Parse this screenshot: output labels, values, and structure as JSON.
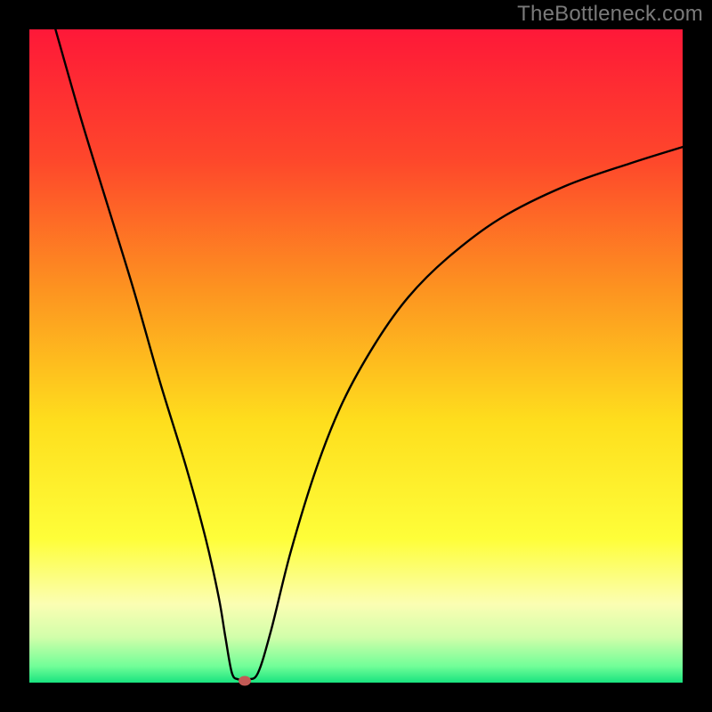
{
  "watermark": "TheBottleneck.com",
  "chart_data": {
    "type": "line",
    "title": "",
    "xlabel": "",
    "ylabel": "",
    "xlim": [
      0,
      100
    ],
    "ylim": [
      0,
      100
    ],
    "grid": false,
    "series": [
      {
        "name": "curve",
        "x": [
          4,
          8,
          12,
          16,
          20,
          24,
          27,
          29,
          30,
          31,
          32,
          33.5,
          35,
          37,
          40,
          44,
          48,
          53,
          58,
          64,
          72,
          82,
          92,
          100
        ],
        "y": [
          100,
          86,
          73,
          60,
          46,
          33,
          22,
          13,
          7,
          1.5,
          0.5,
          0.5,
          1.5,
          8,
          20,
          33,
          43,
          52,
          59,
          65,
          71,
          76,
          79.5,
          82
        ]
      }
    ],
    "marker": {
      "x": 33,
      "y": 0.3
    },
    "gradient_stops": [
      {
        "offset": 0.0,
        "color": "#fe1838"
      },
      {
        "offset": 0.2,
        "color": "#fe472b"
      },
      {
        "offset": 0.4,
        "color": "#fd9420"
      },
      {
        "offset": 0.6,
        "color": "#fede1d"
      },
      {
        "offset": 0.78,
        "color": "#fefe39"
      },
      {
        "offset": 0.88,
        "color": "#fbfeb3"
      },
      {
        "offset": 0.93,
        "color": "#d2feaa"
      },
      {
        "offset": 0.975,
        "color": "#71fe98"
      },
      {
        "offset": 1.0,
        "color": "#19e37f"
      }
    ]
  }
}
